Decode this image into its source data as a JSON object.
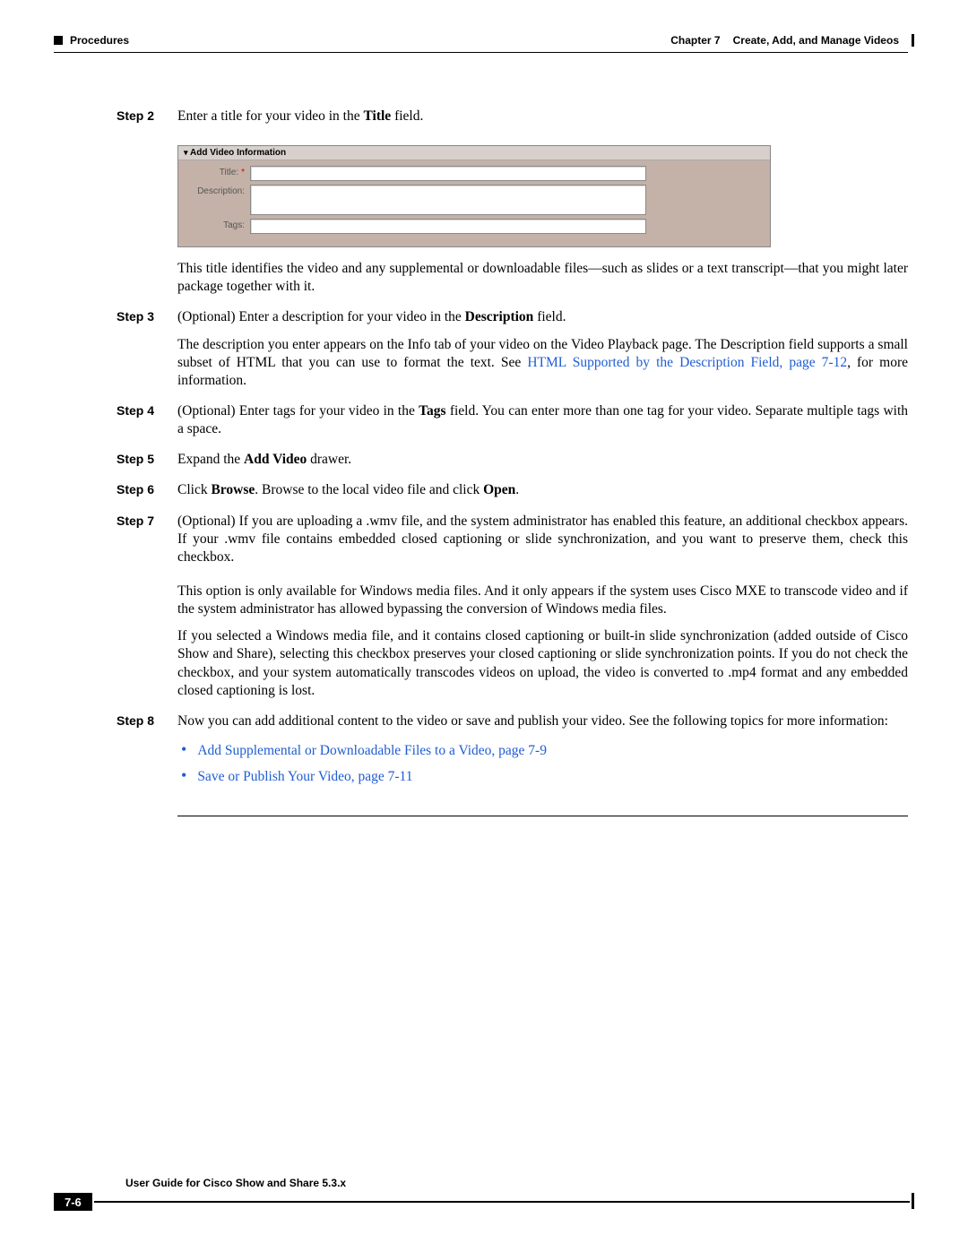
{
  "header": {
    "left_label": "Procedures",
    "chapter_prefix": "Chapter 7",
    "chapter_title": "Create, Add, and Manage Videos"
  },
  "steps": {
    "s2": {
      "label": "Step 2",
      "text_a": "Enter a title for your video in the ",
      "bold_a": "Title",
      "text_b": " field.",
      "after": "This title identifies the video and any supplemental or downloadable files—such as slides or a text transcript—that you might later package together with it."
    },
    "s3": {
      "label": "Step 3",
      "text_a": "(Optional) Enter a description for your video in the ",
      "bold_a": "Description",
      "text_b": " field.",
      "p1_a": "The description you enter appears on the Info tab of your video on the Video Playback page. The Description field supports a small subset of HTML that you can use to format the text. See ",
      "link": "HTML Supported by the Description Field, page 7-12",
      "p1_b": ", for more information."
    },
    "s4": {
      "label": "Step 4",
      "text_a": "(Optional) Enter tags for your video in the ",
      "bold_a": "Tags",
      "text_b": " field. You can enter more than one tag for your video. Separate multiple tags with a space."
    },
    "s5": {
      "label": "Step 5",
      "text_a": "Expand the ",
      "bold_a": "Add Video",
      "text_b": " drawer."
    },
    "s6": {
      "label": "Step 6",
      "text_a": "Click ",
      "bold_a": "Browse",
      "text_b": ". Browse to the local video file and click ",
      "bold_b": "Open",
      "text_c": "."
    },
    "s7": {
      "label": "Step 7",
      "p1": "(Optional) If you are uploading a .wmv file, and the system administrator has enabled this feature, an additional checkbox appears. If your .wmv file contains embedded closed captioning or slide synchronization, and you want to preserve them, check this checkbox.",
      "p2": "This option is only available for Windows media files. And it only appears if the system uses Cisco MXE to transcode video and if the system administrator has allowed bypassing the conversion of Windows media files.",
      "p3": "If you selected a Windows media file, and it contains closed captioning or built-in slide synchronization (added outside of Cisco Show and Share), selecting this checkbox preserves your closed captioning or slide synchronization points. If you do not check the checkbox, and your system automatically transcodes videos on upload, the video is converted to .mp4 format and any embedded closed captioning is lost."
    },
    "s8": {
      "label": "Step 8",
      "p1": "Now you can add additional content to the video or save and publish your video. See the following topics for more information:",
      "bullet1": "Add Supplemental or Downloadable Files to a Video, page 7-9",
      "bullet2": "Save or Publish Your Video, page 7-11"
    }
  },
  "figure": {
    "header": "Add Video Information",
    "title_label": "Title:",
    "description_label": "Description:",
    "tags_label": "Tags:"
  },
  "footer": {
    "guide": "User Guide for Cisco Show and Share 5.3.x",
    "page": "7-6"
  }
}
